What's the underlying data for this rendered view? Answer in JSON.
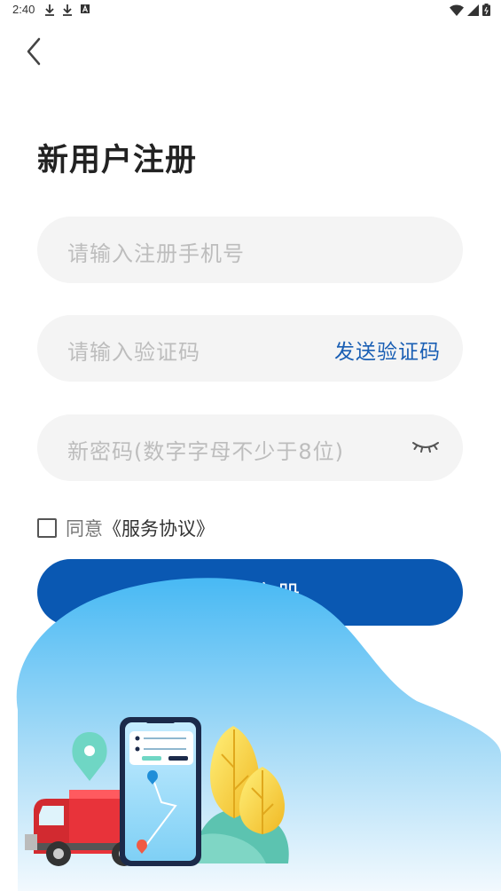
{
  "status_bar": {
    "time": "2:40",
    "left_icons": [
      "download-icon",
      "download-icon",
      "a-icon"
    ],
    "right_icons": [
      "wifi-icon",
      "signal-icon",
      "battery-icon"
    ]
  },
  "header": {
    "back_icon": "chevron-left-icon",
    "title": "新用户注册"
  },
  "form": {
    "phone_placeholder": "请输入注册手机号",
    "code_placeholder": "请输入验证码",
    "send_code_label": "发送验证码",
    "password_placeholder": "新密码(数字字母不少于8位)",
    "password_toggle_icon": "eye-closed-icon",
    "agree_checked": false,
    "agree_text": "同意",
    "agreement_link": "《服务协议》",
    "submit_label": "确定注册"
  },
  "colors": {
    "primary": "#0a58b2",
    "link": "#1a5fb4",
    "field_bg": "#f4f4f4",
    "placeholder": "#bdbdbd"
  },
  "illustration": {
    "icons": [
      "truck-icon",
      "phone-map-icon",
      "location-pin-icon",
      "tree-icon"
    ]
  }
}
